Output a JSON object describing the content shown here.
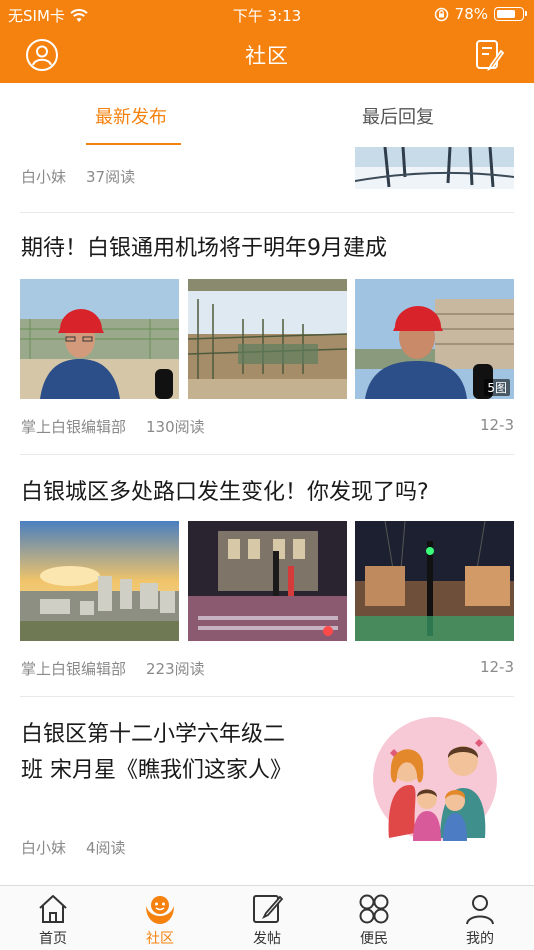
{
  "status_bar": {
    "carrier": "无SIM卡",
    "wifi_icon": "wifi-icon",
    "time": "下午 3:13",
    "lock_icon": "orientation-lock-icon",
    "battery_percent": "78%",
    "battery_level": 0.78
  },
  "nav": {
    "title": "社区",
    "left_icon": "user-icon",
    "right_icon": "edit-icon"
  },
  "tabs": [
    {
      "label": "最新发布",
      "active": true
    },
    {
      "label": "最后回复",
      "active": false
    }
  ],
  "posts": [
    {
      "author": "白小妹",
      "reads": "37阅读"
    },
    {
      "title": "期待！白银通用机场将于明年9月建成",
      "author": "掌上白银编辑部",
      "reads": "130阅读",
      "date": "12-3",
      "image_count": "5图"
    },
    {
      "title": "白银城区多处路口发生变化！你发现了吗?",
      "author": "掌上白银编辑部",
      "reads": "223阅读",
      "date": "12-3"
    },
    {
      "title_line1": "白银区第十二小学六年级二",
      "title_line2": "班 宋月星《瞧我们这家人》",
      "author": "白小妹",
      "reads": "4阅读"
    }
  ],
  "tabbar": [
    {
      "label": "首页",
      "icon": "home-icon",
      "active": false
    },
    {
      "label": "社区",
      "icon": "community-icon",
      "active": true
    },
    {
      "label": "发帖",
      "icon": "compose-icon",
      "active": false
    },
    {
      "label": "便民",
      "icon": "services-icon",
      "active": false
    },
    {
      "label": "我的",
      "icon": "profile-icon",
      "active": false
    }
  ],
  "colors": {
    "accent": "#f5820f",
    "text_primary": "#1a1a1a",
    "text_meta": "#8a8a8a"
  }
}
